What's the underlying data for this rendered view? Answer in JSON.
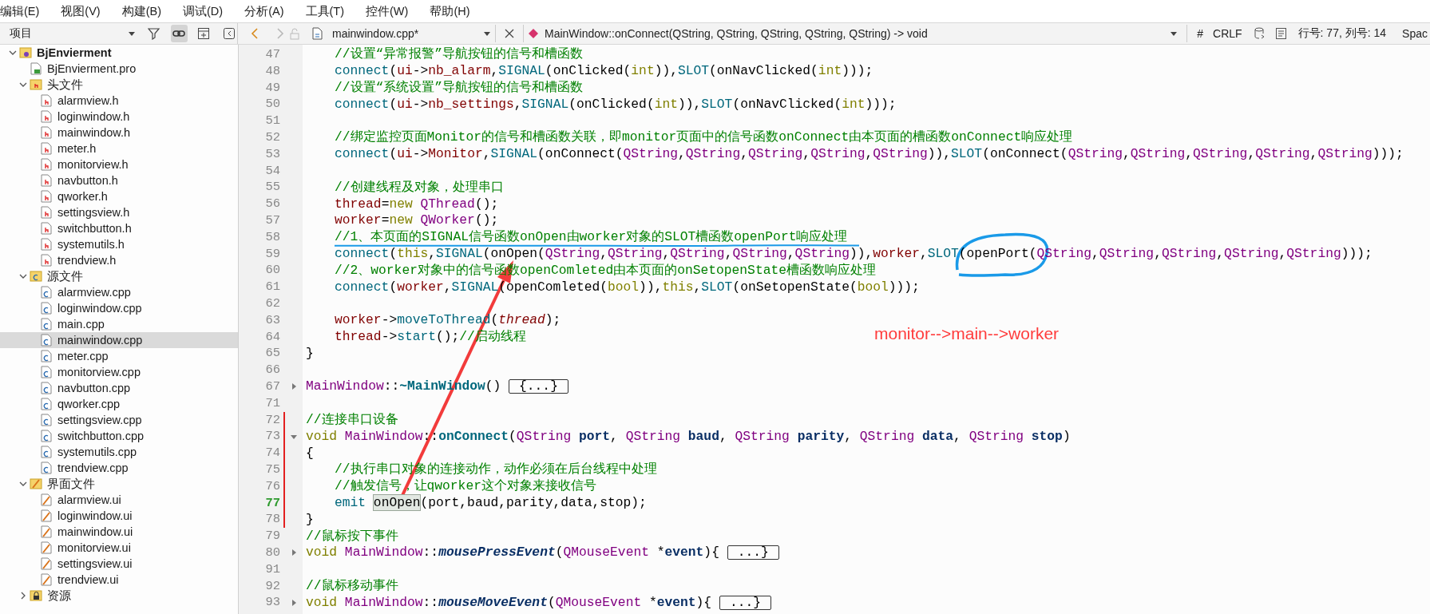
{
  "menu_bar": [
    "编辑(E)",
    "视图(V)",
    "构建(B)",
    "调试(D)",
    "分析(A)",
    "工具(T)",
    "控件(W)",
    "帮助(H)"
  ],
  "sidebar": {
    "view_selector": "项目",
    "tree": [
      {
        "label": "BjEnvierment",
        "kind": "project",
        "expanded": true,
        "selected": false,
        "children": [
          {
            "label": "BjEnvierment.pro",
            "kind": "pro",
            "selected": false
          },
          {
            "label": "头文件",
            "kind": "header-folder",
            "expanded": true,
            "selected": false,
            "children": [
              {
                "label": "alarmview.h",
                "kind": "header",
                "selected": false
              },
              {
                "label": "loginwindow.h",
                "kind": "header",
                "selected": false
              },
              {
                "label": "mainwindow.h",
                "kind": "header",
                "selected": false
              },
              {
                "label": "meter.h",
                "kind": "header",
                "selected": false
              },
              {
                "label": "monitorview.h",
                "kind": "header",
                "selected": false
              },
              {
                "label": "navbutton.h",
                "kind": "header",
                "selected": false
              },
              {
                "label": "qworker.h",
                "kind": "header",
                "selected": false
              },
              {
                "label": "settingsview.h",
                "kind": "header",
                "selected": false
              },
              {
                "label": "switchbutton.h",
                "kind": "header",
                "selected": false
              },
              {
                "label": "systemutils.h",
                "kind": "header",
                "selected": false
              },
              {
                "label": "trendview.h",
                "kind": "header",
                "selected": false
              }
            ]
          },
          {
            "label": "源文件",
            "kind": "source-folder",
            "expanded": true,
            "selected": false,
            "children": [
              {
                "label": "alarmview.cpp",
                "kind": "source",
                "selected": false
              },
              {
                "label": "loginwindow.cpp",
                "kind": "source",
                "selected": false
              },
              {
                "label": "main.cpp",
                "kind": "source",
                "selected": false
              },
              {
                "label": "mainwindow.cpp",
                "kind": "source",
                "selected": true
              },
              {
                "label": "meter.cpp",
                "kind": "source",
                "selected": false
              },
              {
                "label": "monitorview.cpp",
                "kind": "source",
                "selected": false
              },
              {
                "label": "navbutton.cpp",
                "kind": "source",
                "selected": false
              },
              {
                "label": "qworker.cpp",
                "kind": "source",
                "selected": false
              },
              {
                "label": "settingsview.cpp",
                "kind": "source",
                "selected": false
              },
              {
                "label": "switchbutton.cpp",
                "kind": "source",
                "selected": false
              },
              {
                "label": "systemutils.cpp",
                "kind": "source",
                "selected": false
              },
              {
                "label": "trendview.cpp",
                "kind": "source",
                "selected": false
              }
            ]
          },
          {
            "label": "界面文件",
            "kind": "form-folder",
            "expanded": true,
            "selected": false,
            "children": [
              {
                "label": "alarmview.ui",
                "kind": "form",
                "selected": false
              },
              {
                "label": "loginwindow.ui",
                "kind": "form",
                "selected": false
              },
              {
                "label": "mainwindow.ui",
                "kind": "form",
                "selected": false
              },
              {
                "label": "monitorview.ui",
                "kind": "form",
                "selected": false
              },
              {
                "label": "settingsview.ui",
                "kind": "form",
                "selected": false
              },
              {
                "label": "trendview.ui",
                "kind": "form",
                "selected": false
              }
            ]
          },
          {
            "label": "资源",
            "kind": "resource-folder",
            "expanded": false,
            "selected": false
          }
        ]
      }
    ]
  },
  "editor_toolbar": {
    "file_name": "mainwindow.cpp*",
    "symbol": "MainWindow::onConnect(QString, QString, QString, QString, QString) -> void",
    "hash": "#",
    "line_ending": "CRLF",
    "position": "行号: 77, 列号: 14",
    "indent_setting": "Spac"
  },
  "code_lines": [
    {
      "number": "47",
      "indented": true,
      "changed": false,
      "current": false,
      "tokens": [
        {
          "kind": "comment",
          "text": "//设置“异常报警”导航按钮的信号和槽函数"
        }
      ]
    },
    {
      "number": "48",
      "indented": true,
      "changed": false,
      "current": false,
      "tokens": [
        {
          "kind": "call",
          "text": "connect"
        },
        {
          "kind": "plain",
          "text": "("
        },
        {
          "kind": "member",
          "text": "ui"
        },
        {
          "kind": "plain",
          "text": "->"
        },
        {
          "kind": "member",
          "text": "nb_alarm"
        },
        {
          "kind": "plain",
          "text": ","
        },
        {
          "kind": "call",
          "text": "SIGNAL"
        },
        {
          "kind": "plain",
          "text": "(onClicked("
        },
        {
          "kind": "keyword",
          "text": "int"
        },
        {
          "kind": "plain",
          "text": ")),"
        },
        {
          "kind": "call",
          "text": "SLOT"
        },
        {
          "kind": "plain",
          "text": "(onNavClicked("
        },
        {
          "kind": "keyword",
          "text": "int"
        },
        {
          "kind": "plain",
          "text": ")));"
        }
      ]
    },
    {
      "number": "49",
      "indented": true,
      "changed": false,
      "current": false,
      "tokens": [
        {
          "kind": "comment",
          "text": "//设置“系统设置”导航按钮的信号和槽函数"
        }
      ]
    },
    {
      "number": "50",
      "indented": true,
      "changed": false,
      "current": false,
      "tokens": [
        {
          "kind": "call",
          "text": "connect"
        },
        {
          "kind": "plain",
          "text": "("
        },
        {
          "kind": "member",
          "text": "ui"
        },
        {
          "kind": "plain",
          "text": "->"
        },
        {
          "kind": "member",
          "text": "nb_settings"
        },
        {
          "kind": "plain",
          "text": ","
        },
        {
          "kind": "call",
          "text": "SIGNAL"
        },
        {
          "kind": "plain",
          "text": "(onClicked("
        },
        {
          "kind": "keyword",
          "text": "int"
        },
        {
          "kind": "plain",
          "text": ")),"
        },
        {
          "kind": "call",
          "text": "SLOT"
        },
        {
          "kind": "plain",
          "text": "(onNavClicked("
        },
        {
          "kind": "keyword",
          "text": "int"
        },
        {
          "kind": "plain",
          "text": ")));"
        }
      ]
    },
    {
      "number": "51",
      "changed": false,
      "current": false
    },
    {
      "number": "52",
      "indented": true,
      "changed": false,
      "current": false,
      "tokens": [
        {
          "kind": "comment",
          "text": "//绑定监控页面Monitor的信号和槽函数关联，即monitor页面中的信号函数onConnect由本页面的槽函数onConnect响应处理"
        }
      ]
    },
    {
      "number": "53",
      "indented": true,
      "changed": false,
      "current": false,
      "tokens": [
        {
          "kind": "call",
          "text": "connect"
        },
        {
          "kind": "plain",
          "text": "("
        },
        {
          "kind": "member",
          "text": "ui"
        },
        {
          "kind": "plain",
          "text": "->"
        },
        {
          "kind": "member",
          "text": "Monitor"
        },
        {
          "kind": "plain",
          "text": ","
        },
        {
          "kind": "call",
          "text": "SIGNAL"
        },
        {
          "kind": "plain",
          "text": "(onConnect("
        },
        {
          "kind": "type",
          "text": "QString"
        },
        {
          "kind": "plain",
          "text": ","
        },
        {
          "kind": "type",
          "text": "QString"
        },
        {
          "kind": "plain",
          "text": ","
        },
        {
          "kind": "type",
          "text": "QString"
        },
        {
          "kind": "plain",
          "text": ","
        },
        {
          "kind": "type",
          "text": "QString"
        },
        {
          "kind": "plain",
          "text": ","
        },
        {
          "kind": "type",
          "text": "QString"
        },
        {
          "kind": "plain",
          "text": ")),"
        },
        {
          "kind": "call",
          "text": "SLOT"
        },
        {
          "kind": "plain",
          "text": "(onConnect("
        },
        {
          "kind": "type",
          "text": "QString"
        },
        {
          "kind": "plain",
          "text": ","
        },
        {
          "kind": "type",
          "text": "QString"
        },
        {
          "kind": "plain",
          "text": ","
        },
        {
          "kind": "type",
          "text": "QString"
        },
        {
          "kind": "plain",
          "text": ","
        },
        {
          "kind": "type",
          "text": "QString"
        },
        {
          "kind": "plain",
          "text": ","
        },
        {
          "kind": "type",
          "text": "QString"
        },
        {
          "kind": "plain",
          "text": ")));"
        }
      ]
    },
    {
      "number": "54",
      "changed": false,
      "current": false
    },
    {
      "number": "55",
      "indented": true,
      "changed": false,
      "current": false,
      "tokens": [
        {
          "kind": "comment",
          "text": "//创建线程及对象，处理串口"
        }
      ]
    },
    {
      "number": "56",
      "indented": true,
      "changed": false,
      "current": false,
      "tokens": [
        {
          "kind": "member",
          "text": "thread"
        },
        {
          "kind": "plain",
          "text": "="
        },
        {
          "kind": "keyword",
          "text": "new"
        },
        {
          "kind": "type",
          "text": "QThread",
          "spaced": true
        },
        {
          "kind": "plain",
          "text": "();"
        }
      ]
    },
    {
      "number": "57",
      "indented": true,
      "changed": false,
      "current": false,
      "tokens": [
        {
          "kind": "member",
          "text": "worker"
        },
        {
          "kind": "plain",
          "text": "="
        },
        {
          "kind": "keyword",
          "text": "new"
        },
        {
          "kind": "type",
          "text": "QWorker",
          "spaced": true
        },
        {
          "kind": "plain",
          "text": "();"
        }
      ]
    },
    {
      "number": "58",
      "indented": true,
      "changed": false,
      "current": false,
      "tokens": [
        {
          "kind": "comment",
          "text": "//1、本页面的SIGNAL信号函数onOpen由worker对象的SLOT槽函数openPort响应处理"
        }
      ]
    },
    {
      "number": "59",
      "indented": true,
      "changed": false,
      "current": false,
      "tokens": [
        {
          "kind": "call",
          "text": "connect"
        },
        {
          "kind": "plain",
          "text": "("
        },
        {
          "kind": "keyword",
          "text": "this"
        },
        {
          "kind": "plain",
          "text": ","
        },
        {
          "kind": "call",
          "text": "SIGNAL"
        },
        {
          "kind": "plain",
          "text": "(onOpen("
        },
        {
          "kind": "type",
          "text": "QString"
        },
        {
          "kind": "plain",
          "text": ","
        },
        {
          "kind": "type",
          "text": "QString"
        },
        {
          "kind": "plain",
          "text": ","
        },
        {
          "kind": "type",
          "text": "QString"
        },
        {
          "kind": "plain",
          "text": ","
        },
        {
          "kind": "type",
          "text": "QString"
        },
        {
          "kind": "plain",
          "text": ","
        },
        {
          "kind": "type",
          "text": "QString"
        },
        {
          "kind": "plain",
          "text": ")),"
        },
        {
          "kind": "member",
          "text": "worker"
        },
        {
          "kind": "plain",
          "text": ","
        },
        {
          "kind": "call",
          "text": "SLOT"
        },
        {
          "kind": "plain",
          "text": "(openPort("
        },
        {
          "kind": "type",
          "text": "QString"
        },
        {
          "kind": "plain",
          "text": ","
        },
        {
          "kind": "type",
          "text": "QString"
        },
        {
          "kind": "plain",
          "text": ","
        },
        {
          "kind": "type",
          "text": "QString"
        },
        {
          "kind": "plain",
          "text": ","
        },
        {
          "kind": "type",
          "text": "QString"
        },
        {
          "kind": "plain",
          "text": ","
        },
        {
          "kind": "type",
          "text": "QString"
        },
        {
          "kind": "plain",
          "text": ")));"
        }
      ]
    },
    {
      "number": "60",
      "indented": true,
      "changed": false,
      "current": false,
      "tokens": [
        {
          "kind": "comment",
          "text": "//2、worker对象中的信号函数openComleted由本页面的onSetopenState槽函数响应处理"
        }
      ]
    },
    {
      "number": "61",
      "indented": true,
      "changed": false,
      "current": false,
      "tokens": [
        {
          "kind": "call",
          "text": "connect"
        },
        {
          "kind": "plain",
          "text": "("
        },
        {
          "kind": "member",
          "text": "worker"
        },
        {
          "kind": "plain",
          "text": ","
        },
        {
          "kind": "call",
          "text": "SIGNAL"
        },
        {
          "kind": "plain",
          "text": "(openComleted("
        },
        {
          "kind": "keyword",
          "text": "bool"
        },
        {
          "kind": "plain",
          "text": ")),"
        },
        {
          "kind": "keyword",
          "text": "this"
        },
        {
          "kind": "plain",
          "text": ","
        },
        {
          "kind": "call",
          "text": "SLOT"
        },
        {
          "kind": "plain",
          "text": "(onSetopenState("
        },
        {
          "kind": "keyword",
          "text": "bool"
        },
        {
          "kind": "plain",
          "text": ")));"
        }
      ]
    },
    {
      "number": "62",
      "changed": false,
      "current": false
    },
    {
      "number": "63",
      "indented": true,
      "changed": false,
      "current": false,
      "tokens": [
        {
          "kind": "member",
          "text": "worker"
        },
        {
          "kind": "plain",
          "text": "->"
        },
        {
          "kind": "call",
          "text": "moveToThread"
        },
        {
          "kind": "plain",
          "text": "("
        },
        {
          "kind": "member-italic",
          "text": "thread"
        },
        {
          "kind": "plain",
          "text": ");"
        }
      ]
    },
    {
      "number": "64",
      "indented": true,
      "changed": false,
      "current": false,
      "tokens": [
        {
          "kind": "member",
          "text": "thread"
        },
        {
          "kind": "plain",
          "text": "->"
        },
        {
          "kind": "call",
          "text": "start"
        },
        {
          "kind": "plain",
          "text": "();"
        },
        {
          "kind": "comment",
          "text": "//启动线程"
        }
      ]
    },
    {
      "number": "65",
      "indented": false,
      "changed": false,
      "current": false,
      "tokens": [
        {
          "kind": "plain",
          "text": "}"
        }
      ]
    },
    {
      "number": "66",
      "changed": false,
      "current": false
    },
    {
      "number": "67",
      "indented": false,
      "changed": false,
      "current": false,
      "collapsed": true,
      "tokens": [
        {
          "kind": "type",
          "text": "MainWindow"
        },
        {
          "kind": "plain",
          "text": "::"
        },
        {
          "kind": "definition",
          "text": "~MainWindow"
        },
        {
          "kind": "plain",
          "text": "()"
        },
        {
          "kind": "folded",
          "text": "{...}",
          "spaced": true
        }
      ]
    },
    {
      "number": "71",
      "changed": false,
      "current": false
    },
    {
      "number": "72",
      "indented": false,
      "changed": true,
      "current": false,
      "tokens": [
        {
          "kind": "comment",
          "text": "//连接串口设备"
        }
      ]
    },
    {
      "number": "73",
      "indented": false,
      "changed": true,
      "current": false,
      "collapsed": false,
      "tokens": [
        {
          "kind": "keyword",
          "text": "void"
        },
        {
          "kind": "type",
          "text": "MainWindow",
          "spaced": true
        },
        {
          "kind": "plain",
          "text": "::"
        },
        {
          "kind": "definition",
          "text": "onConnect"
        },
        {
          "kind": "plain",
          "text": "("
        },
        {
          "kind": "type",
          "text": "QString"
        },
        {
          "kind": "param",
          "text": "port",
          "spaced": true
        },
        {
          "kind": "plain",
          "text": ", "
        },
        {
          "kind": "type",
          "text": "QString"
        },
        {
          "kind": "param",
          "text": "baud",
          "spaced": true
        },
        {
          "kind": "plain",
          "text": ", "
        },
        {
          "kind": "type",
          "text": "QString"
        },
        {
          "kind": "param",
          "text": "parity",
          "spaced": true
        },
        {
          "kind": "plain",
          "text": ", "
        },
        {
          "kind": "type",
          "text": "QString"
        },
        {
          "kind": "param",
          "text": "data",
          "spaced": true
        },
        {
          "kind": "plain",
          "text": ", "
        },
        {
          "kind": "type",
          "text": "QString"
        },
        {
          "kind": "param",
          "text": "stop",
          "spaced": true
        },
        {
          "kind": "plain",
          "text": ")"
        }
      ]
    },
    {
      "number": "74",
      "indented": false,
      "changed": true,
      "current": false,
      "tokens": [
        {
          "kind": "plain",
          "text": "{"
        }
      ]
    },
    {
      "number": "75",
      "indented": true,
      "changed": true,
      "current": false,
      "tokens": [
        {
          "kind": "comment",
          "text": "//执行串口对象的连接动作，动作必须在后台线程中处理"
        }
      ]
    },
    {
      "number": "76",
      "indented": true,
      "changed": true,
      "current": false,
      "tokens": [
        {
          "kind": "comment",
          "text": "//触发信号，让qworker这个对象来接收信号"
        }
      ]
    },
    {
      "number": "77",
      "indented": true,
      "changed": true,
      "current": true,
      "tokens": [
        {
          "kind": "call",
          "text": "emit"
        },
        {
          "kind": "highlight",
          "text": "onOpen",
          "spaced": true
        },
        {
          "kind": "plain",
          "text": "(port,baud,parity,data,stop);"
        }
      ]
    },
    {
      "number": "78",
      "indented": false,
      "changed": true,
      "current": false,
      "tokens": [
        {
          "kind": "plain",
          "text": "}"
        }
      ]
    },
    {
      "number": "79",
      "indented": false,
      "changed": false,
      "current": false,
      "tokens": [
        {
          "kind": "comment",
          "text": "//鼠标按下事件"
        }
      ]
    },
    {
      "number": "80",
      "indented": false,
      "changed": false,
      "current": false,
      "collapsed": true,
      "tokens": [
        {
          "kind": "keyword",
          "text": "void"
        },
        {
          "kind": "type",
          "text": "MainWindow",
          "spaced": true
        },
        {
          "kind": "plain",
          "text": "::"
        },
        {
          "kind": "definition-italic",
          "text": "mousePressEvent"
        },
        {
          "kind": "plain",
          "text": "("
        },
        {
          "kind": "type",
          "text": "QMouseEvent"
        },
        {
          "kind": "plain",
          "text": "*",
          "spaced": true
        },
        {
          "kind": "param",
          "text": "event"
        },
        {
          "kind": "plain",
          "text": "){"
        },
        {
          "kind": "folded",
          "text": "...}",
          "spaced": true
        }
      ]
    },
    {
      "number": "91",
      "changed": false,
      "current": false
    },
    {
      "number": "92",
      "indented": false,
      "changed": false,
      "current": false,
      "tokens": [
        {
          "kind": "comment",
          "text": "//鼠标移动事件"
        }
      ]
    },
    {
      "number": "93",
      "indented": false,
      "changed": false,
      "current": false,
      "collapsed": true,
      "tokens": [
        {
          "kind": "keyword",
          "text": "void"
        },
        {
          "kind": "type",
          "text": "MainWindow",
          "spaced": true
        },
        {
          "kind": "plain",
          "text": "::"
        },
        {
          "kind": "definition-italic",
          "text": "mouseMoveEvent"
        },
        {
          "kind": "plain",
          "text": "("
        },
        {
          "kind": "type",
          "text": "QMouseEvent"
        },
        {
          "kind": "plain",
          "text": "*",
          "spaced": true
        },
        {
          "kind": "param",
          "text": "event"
        },
        {
          "kind": "plain",
          "text": "){"
        },
        {
          "kind": "folded",
          "text": "...}",
          "spaced": true
        }
      ]
    }
  ],
  "annotation": {
    "note": "monitor-->main-->worker"
  }
}
